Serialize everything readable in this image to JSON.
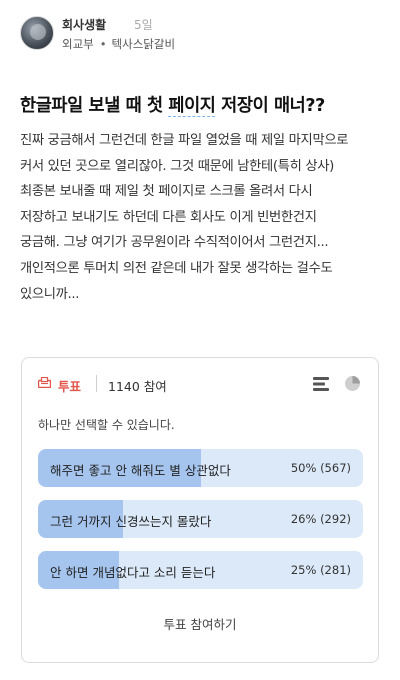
{
  "post": {
    "board": "회사생활",
    "time_ago": "5일",
    "company": "외교부",
    "nickname": "텍사스닭갈비",
    "title_pre": "한글파일 보낼 때 첫 ",
    "title_underlined": "페이지",
    "title_post": " 저장이 매너??",
    "body_lines": [
      "진짜 궁금해서 그런건데 한글 파일 열었을 때 제일 마지막으로",
      "커서 있던 곳으로 열리잖아. 그것 때문에 남한테(특히 상사)",
      "최종본 보내줄 때 제일 첫 페이지로 스크롤 올려서 다시",
      "저장하고 보내기도 하던데 다른 회사도 이게 빈번한건지",
      "궁금해. 그냥 여기가 공무원이라 수직적이어서 그런건지...",
      "개인적으론 투머치 의전 같은데 내가 잘못 생각하는 걸수도",
      "있으니까..."
    ]
  },
  "poll": {
    "label": "투표",
    "participants": "1140 참여",
    "note": "하나만 선택할 수 있습니다.",
    "options": [
      {
        "label": "해주면 좋고 안 해줘도 별 상관없다",
        "stat": "50% (567)",
        "percent": 50
      },
      {
        "label": "그런 거까지 신경쓰는지 몰랐다",
        "stat": "26% (292)",
        "percent": 26
      },
      {
        "label": "안 하면 개념없다고 소리 듣는다",
        "stat": "25% (281)",
        "percent": 25
      }
    ],
    "participate_label": "투표 참여하기"
  },
  "icons": {
    "vote": "ballot-box-icon",
    "bar_chart": "bar-chart-icon",
    "pie_chart": "pie-chart-icon"
  },
  "colors": {
    "vote_accent": "#e2574c",
    "bar_track": "#dce9f8",
    "bar_fill": "#a6c5ee",
    "title_underline": "#7fb3e8"
  }
}
